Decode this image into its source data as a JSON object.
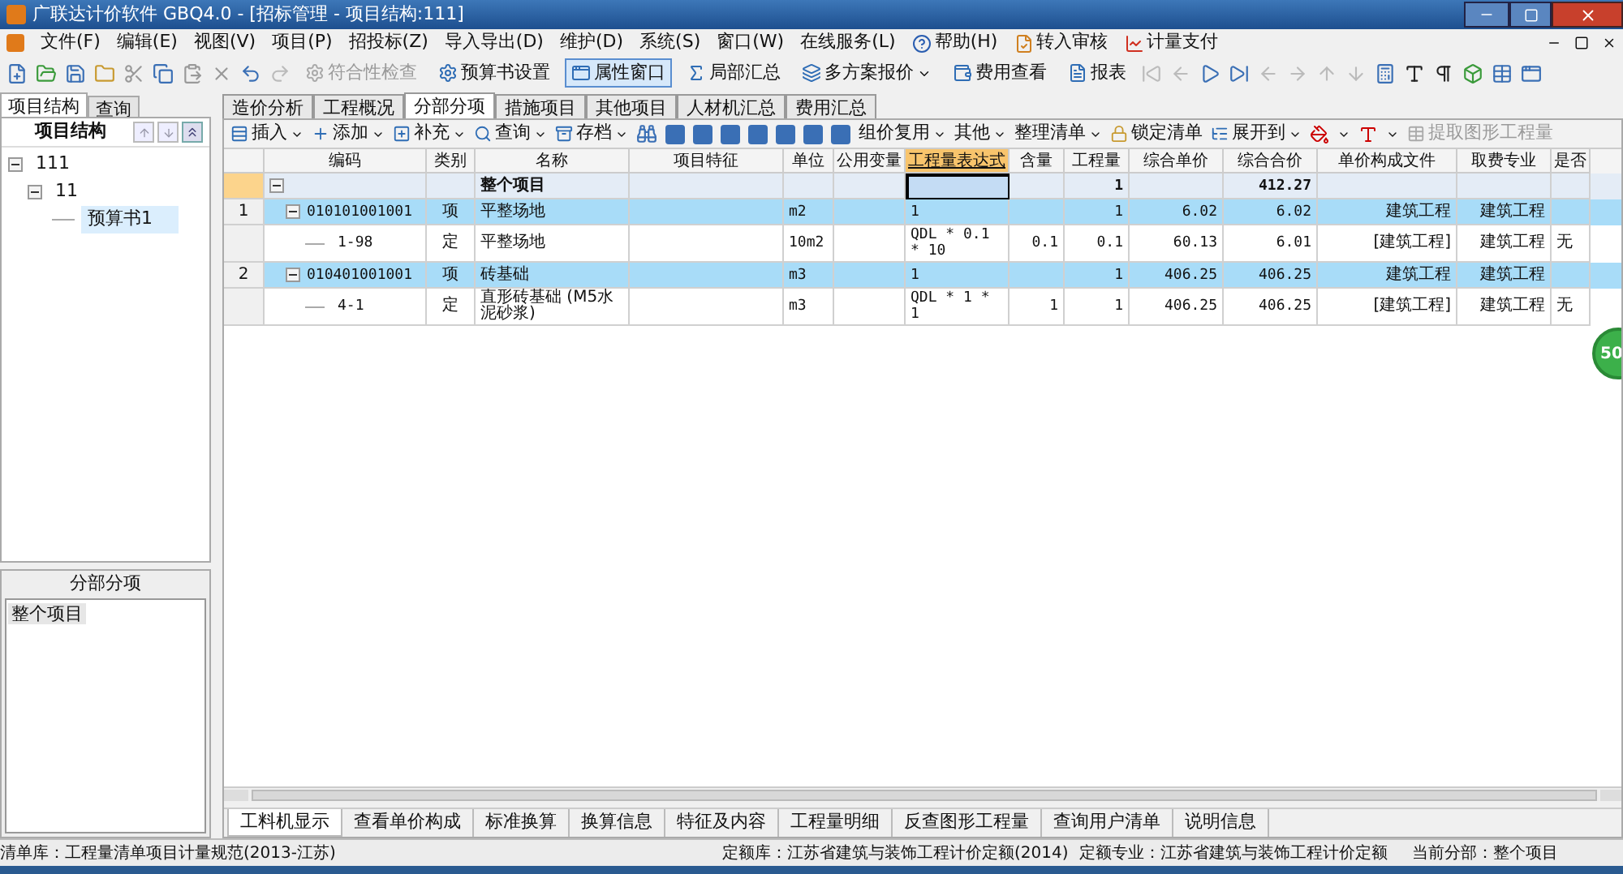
{
  "window": {
    "title": "广联达计价软件 GBQ4.0 - [招标管理 - 项目结构:111]"
  },
  "menu": [
    {
      "label": "文件(F)",
      "kind": "text"
    },
    {
      "label": "编辑(E)",
      "kind": "text"
    },
    {
      "label": "视图(V)",
      "kind": "text"
    },
    {
      "label": "项目(P)",
      "kind": "text"
    },
    {
      "label": "招投标(Z)",
      "kind": "text"
    },
    {
      "label": "导入导出(D)",
      "kind": "text"
    },
    {
      "label": "维护(D)",
      "kind": "text"
    },
    {
      "label": "系统(S)",
      "kind": "text"
    },
    {
      "label": "窗口(W)",
      "kind": "text"
    },
    {
      "label": "在线服务(L)",
      "kind": "text"
    },
    {
      "label": "帮助(H)",
      "kind": "help"
    },
    {
      "label": "转入审核",
      "kind": "audit"
    },
    {
      "label": "计量支付",
      "kind": "pay"
    }
  ],
  "toolbar": [
    {
      "label": "符合性检查",
      "disabled": true,
      "selected": false
    },
    {
      "label": "预算书设置",
      "disabled": false,
      "selected": false
    },
    {
      "label": "属性窗口",
      "disabled": false,
      "selected": true
    },
    {
      "label": "局部汇总",
      "disabled": false,
      "selected": false
    },
    {
      "label": "多方案报价",
      "disabled": false,
      "selected": false,
      "dropdown": true
    },
    {
      "label": "费用查看",
      "disabled": false,
      "selected": false
    },
    {
      "label": "报表",
      "disabled": false,
      "selected": false
    }
  ],
  "left_panel": {
    "tabs": [
      {
        "label": "项目结构",
        "selected": true
      },
      {
        "label": "查询",
        "selected": false
      }
    ],
    "header": "项目结构",
    "tree": [
      {
        "label": "111",
        "expanded": true,
        "selected": false,
        "children": [
          {
            "label": "11",
            "expanded": true,
            "selected": false,
            "children": [
              {
                "label": "预算书1",
                "selected": true
              }
            ]
          }
        ]
      }
    ],
    "section_header": "分部分项",
    "section_items": [
      {
        "label": "整个项目",
        "selected": true
      }
    ]
  },
  "main_tabs": [
    {
      "label": "造价分析",
      "selected": false
    },
    {
      "label": "工程概况",
      "selected": false
    },
    {
      "label": "分部分项",
      "selected": true
    },
    {
      "label": "措施项目",
      "selected": false
    },
    {
      "label": "其他项目",
      "selected": false
    },
    {
      "label": "人材机汇总",
      "selected": false
    },
    {
      "label": "费用汇总",
      "selected": false
    }
  ],
  "edit_toolbar": [
    {
      "label": "插入",
      "kind": "button",
      "dropdown": true,
      "disabled": false
    },
    {
      "label": "添加",
      "kind": "button",
      "dropdown": true,
      "disabled": false
    },
    {
      "label": "补充",
      "kind": "button",
      "dropdown": true,
      "disabled": false
    },
    {
      "label": "查询",
      "kind": "button",
      "dropdown": true,
      "disabled": false
    },
    {
      "label": "存档",
      "kind": "button",
      "dropdown": true,
      "disabled": false
    },
    {
      "kind": "icons"
    },
    {
      "label": "组价复用",
      "kind": "button",
      "dropdown": true,
      "disabled": false
    },
    {
      "label": "其他",
      "kind": "button",
      "dropdown": true,
      "disabled": false
    },
    {
      "label": "整理清单",
      "kind": "button",
      "dropdown": true,
      "disabled": false
    },
    {
      "label": "锁定清单",
      "kind": "button",
      "dropdown": false,
      "disabled": false
    },
    {
      "label": "展开到",
      "kind": "button",
      "dropdown": true,
      "disabled": false
    },
    {
      "kind": "colors"
    },
    {
      "label": "提取图形工程量",
      "kind": "button",
      "dropdown": false,
      "disabled": true
    }
  ],
  "table": {
    "columns": [
      {
        "selected": false
      },
      {
        "label": "编码",
        "selected": false
      },
      {
        "label": "类别",
        "selected": false
      },
      {
        "label": "名称",
        "selected": false
      },
      {
        "label": "项目特征",
        "selected": false
      },
      {
        "label": "单位",
        "selected": false
      },
      {
        "label": "公用变量",
        "selected": false
      },
      {
        "label": "工程量表达式",
        "selected": true
      },
      {
        "label": "含量",
        "selected": false
      },
      {
        "label": "工程量",
        "selected": false
      },
      {
        "label": "综合单价",
        "selected": false
      },
      {
        "label": "综合合价",
        "selected": false
      },
      {
        "label": "单价构成文件",
        "selected": false
      },
      {
        "label": "取费专业",
        "selected": false
      },
      {
        "label": "是否",
        "selected": false
      }
    ],
    "rows": [
      {
        "kind": "root",
        "expanded": true,
        "current": true,
        "cells": [
          "",
          "",
          "",
          "整个项目",
          "",
          "",
          "",
          "",
          "",
          "1",
          "",
          "412.27",
          "",
          "",
          ""
        ]
      },
      {
        "kind": "list",
        "expanded": true,
        "current": false,
        "cells": [
          "1",
          "010101001001",
          "项",
          "平整场地",
          "",
          "m2",
          "",
          "1",
          "",
          "1",
          "6.02",
          "6.02",
          "建筑工程",
          "建筑工程",
          ""
        ]
      },
      {
        "kind": "quota",
        "current": false,
        "cells": [
          "",
          "1-98",
          "定",
          "平整场地",
          "",
          "10m2",
          "",
          "QDL * 0.1 * 10",
          "0.1",
          "0.1",
          "60.13",
          "6.01",
          "[建筑工程]",
          "建筑工程",
          "无"
        ]
      },
      {
        "kind": "list",
        "expanded": true,
        "current": false,
        "cells": [
          "2",
          "010401001001",
          "项",
          "砖基础",
          "",
          "m3",
          "",
          "1",
          "",
          "1",
          "406.25",
          "406.25",
          "建筑工程",
          "建筑工程",
          ""
        ]
      },
      {
        "kind": "quota",
        "current": false,
        "cells": [
          "",
          "4-1",
          "定",
          "直形砖基础 (M5水泥砂浆)",
          "",
          "m3",
          "",
          "QDL * 1 * 1",
          "1",
          "1",
          "406.25",
          "406.25",
          "[建筑工程]",
          "建筑工程",
          "无"
        ]
      }
    ]
  },
  "floating_badge": "50",
  "bottom_tabs": [
    {
      "label": "工料机显示",
      "selected": true
    },
    {
      "label": "查看单价构成",
      "selected": false
    },
    {
      "label": "标准换算",
      "selected": false
    },
    {
      "label": "换算信息",
      "selected": false
    },
    {
      "label": "特征及内容",
      "selected": false
    },
    {
      "label": "工程量明细",
      "selected": false
    },
    {
      "label": "反查图形工程量",
      "selected": false
    },
    {
      "label": "查询用户清单",
      "selected": false
    },
    {
      "label": "说明信息",
      "selected": false
    }
  ],
  "status_bar": [
    "清单库：工程量清单项目计量规范(2013-江苏)",
    "定额库：江苏省建筑与装饰工程计价定额(2014)",
    "定额专业：江苏省建筑与装饰工程计价定额",
    "当前分部：整个项目"
  ]
}
